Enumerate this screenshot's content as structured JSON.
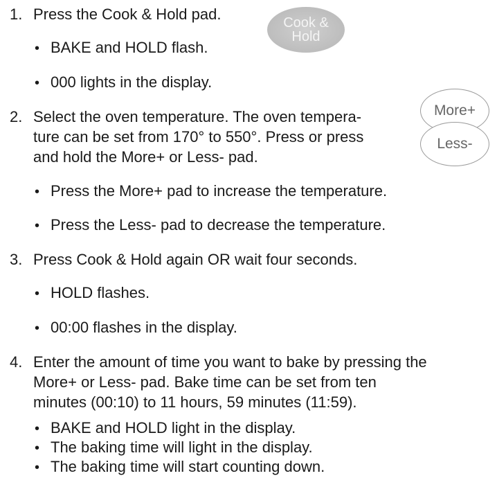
{
  "steps": [
    {
      "number": "1.",
      "lines": [
        "Press the Cook & Hold pad."
      ],
      "bullets": [
        "BAKE and HOLD flash.",
        "000 lights in the display."
      ]
    },
    {
      "number": "2.",
      "lines": [
        "Select the oven temperature. The oven tempera-",
        "ture can be set from 170° to 550°. Press or press",
        "and hold the More+ or Less- pad."
      ],
      "bullets": [
        "Press the More+ pad to increase the temperature.",
        "Press the Less- pad to decrease the temperature."
      ]
    },
    {
      "number": "3.",
      "lines": [
        "Press Cook & Hold again OR wait four seconds."
      ],
      "bullets": [
        "HOLD flashes.",
        "00:00 flashes in the display."
      ]
    },
    {
      "number": "4.",
      "lines": [
        "Enter the amount of time you want to bake by pressing the",
        "More+ or Less- pad. Bake time can be set from ten",
        "minutes (00:10) to 11 hours, 59 minutes (11:59)."
      ],
      "bullets": [
        "BAKE and HOLD light in the display.",
        "The baking time will light in the display.",
        "The baking time will start counting down."
      ]
    }
  ],
  "pads": {
    "cook_hold": [
      "Cook &",
      "Hold"
    ],
    "more": "More+",
    "less": "Less-"
  },
  "bullet_char": "•"
}
